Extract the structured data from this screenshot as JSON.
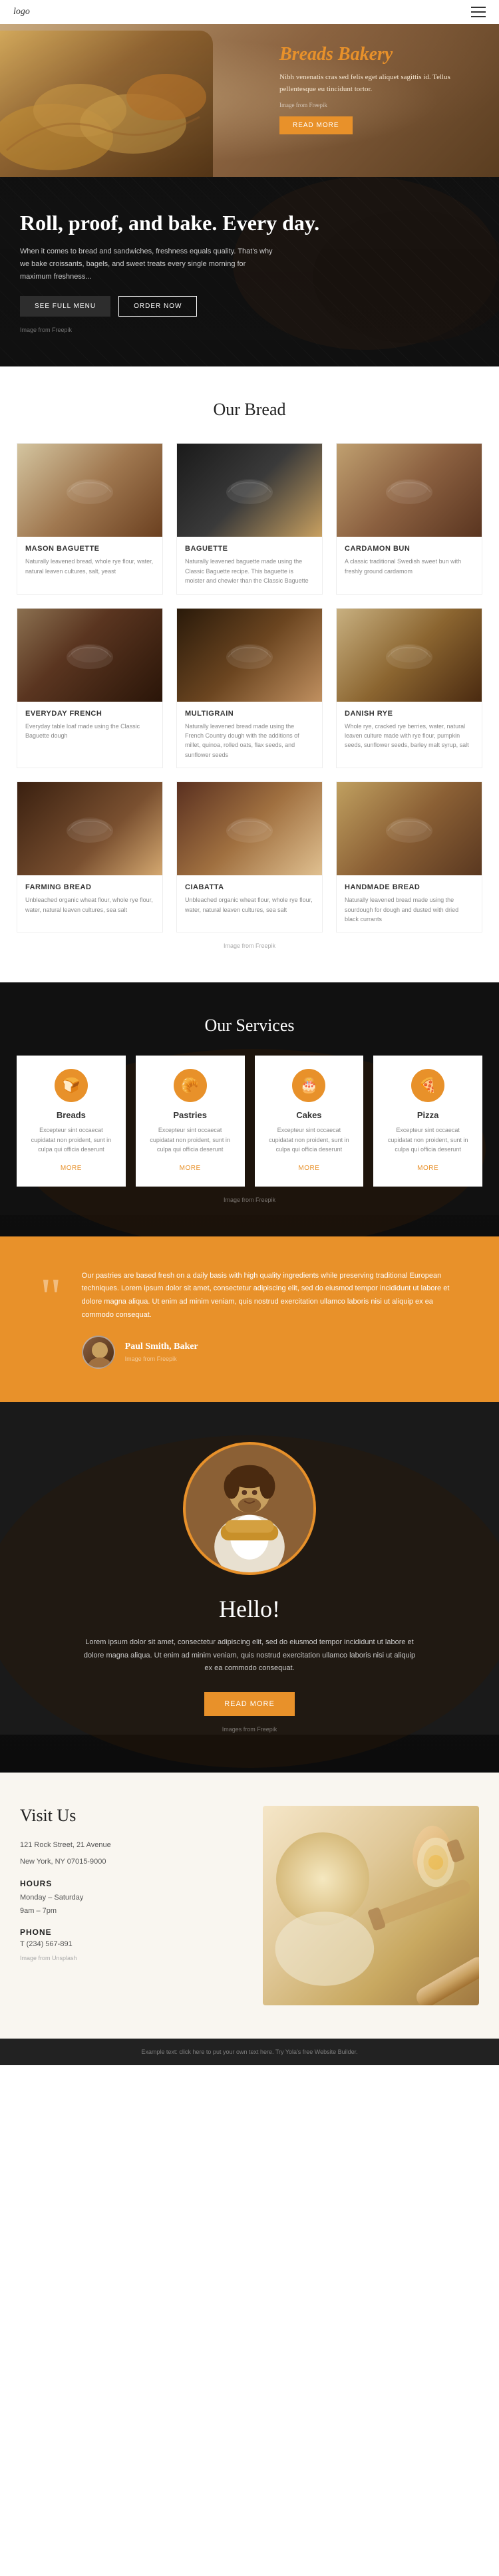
{
  "header": {
    "logo": "logo",
    "nav_icon": "☰"
  },
  "hero": {
    "title": "Breads Bakery",
    "text": "Nibh venenatis cras sed felis eget aliquet sagittis id. Tellus pellentesque eu tincidunt tortor.",
    "image_credit": "Image from Freepik",
    "read_more": "READ MORE"
  },
  "dark_section": {
    "title": "Roll, proof, and bake. Every day.",
    "subtitle": "When it comes to bread and sandwiches, freshness equals quality. That's why we bake croissants, bagels, and sweet treats every single morning for maximum freshness...",
    "btn_menu": "SEE FULL MENU",
    "btn_order": "ORDER NOW",
    "image_credit": "Image from Freepik"
  },
  "our_bread": {
    "title": "Our Bread",
    "image_credit": "Image from Freepik",
    "cards": [
      {
        "title": "Mason Baguette",
        "text": "Naturally leavened bread, whole rye flour, water, natural leaven cultures, salt, yeast",
        "img_class": "img-mason"
      },
      {
        "title": "Baguette",
        "text": "Naturally leavened baguette made using the Classic Baguette recipe. This baguette is moister and chewier than the Classic Baguette",
        "img_class": "img-baguette"
      },
      {
        "title": "Cardamon Bun",
        "text": "A classic traditional Swedish sweet bun with freshly ground cardamom",
        "img_class": "img-cardamon"
      },
      {
        "title": "Everyday French",
        "text": "Everyday table loaf made using the Classic Baguette dough",
        "img_class": "img-everyday"
      },
      {
        "title": "Multigrain",
        "text": "Naturally leavened bread made using the French Country dough with the additions of millet, quinoa, rolled oats, flax seeds, and sunflower seeds",
        "img_class": "img-multigrain"
      },
      {
        "title": "Danish Rye",
        "text": "Whole rye, cracked rye berries, water, natural leaven culture made with rye flour, pumpkin seeds, sunflower seeds, barley malt syrup, salt",
        "img_class": "img-danish"
      },
      {
        "title": "Farming Bread",
        "text": "Unbleached organic wheat flour, whole rye flour, water, natural leaven cultures, sea salt",
        "img_class": "img-farming"
      },
      {
        "title": "Ciabatta",
        "text": "Unbleached organic wheat flour, whole rye flour, water, natural leaven cultures, sea salt",
        "img_class": "img-ciabatta"
      },
      {
        "title": "Handmade Bread",
        "text": "Naturally leavened bread made using the sourdough for dough and dusted with dried black currants",
        "img_class": "img-handmade"
      }
    ]
  },
  "services": {
    "title": "Our Services",
    "image_credit": "Image from Freepik",
    "items": [
      {
        "icon": "🍞",
        "title": "Breads",
        "text": "Excepteur sint occaecat cupidatat non proident, sunt in culpa qui officia deserunt",
        "more": "MORE"
      },
      {
        "icon": "🥐",
        "title": "Pastries",
        "text": "Excepteur sint occaecat cupidatat non proident, sunt in culpa qui officia deserunt",
        "more": "MORE"
      },
      {
        "icon": "🎂",
        "title": "Cakes",
        "text": "Excepteur sint occaecat cupidatat non proident, sunt in culpa qui officia deserunt",
        "more": "MORE"
      },
      {
        "icon": "🍕",
        "title": "Pizza",
        "text": "Excepteur sint occaecat cupidatat non proident, sunt in culpa qui officia deserunt",
        "more": "MORE"
      }
    ]
  },
  "testimonial": {
    "quote": "Our pastries are based fresh on a daily basis with high quality ingredients while preserving traditional European techniques. Lorem ipsum dolor sit amet, consectetur adipiscing elit, sed do eiusmod tempor incididunt ut labore et dolore magna aliqua. Ut enim ad minim veniam, quis nostrud exercitation ullamco laboris nisi ut aliquip ex ea commodo consequat.",
    "author_name": "Paul Smith, Baker",
    "image_credit": "Image from Freepik"
  },
  "hello": {
    "title": "Hello!",
    "text": "Lorem ipsum dolor sit amet, consectetur adipiscing elit, sed do eiusmod tempor incididunt ut labore et dolore magna aliqua. Ut enim ad minim veniam, quis nostrud exercitation ullamco laboris nisi ut aliquip ex ea commodo consequat.",
    "btn_read_more": "READ MORE",
    "images_credit": "Images from Freepik"
  },
  "visit": {
    "title": "Visit Us",
    "address_line1": "121 Rock Street, 21 Avenue",
    "address_line2": "New York, NY 07015-9000",
    "hours_label": "HOURS",
    "hours_days": "Monday – Saturday",
    "hours_time": "9am – 7pm",
    "phone_label": "PHONE",
    "phone": "T (234) 567-891",
    "image_credit": "Image from Unsplash"
  },
  "footer": {
    "text": "Example text: click here to put your own text here. Try Yola's free Website Builder."
  }
}
